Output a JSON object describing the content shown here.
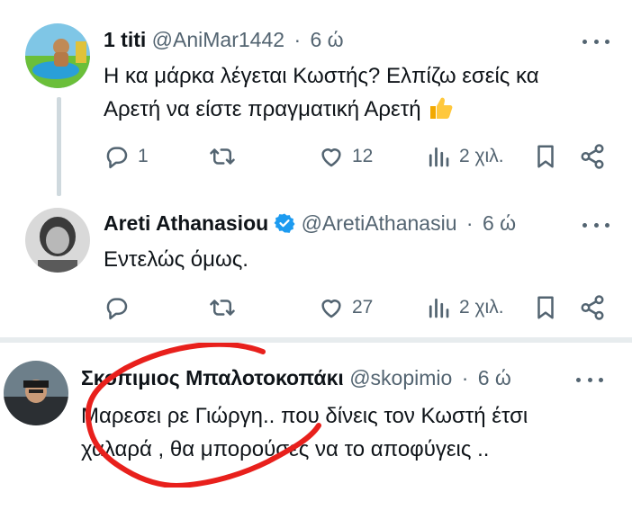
{
  "tweets": [
    {
      "name": "1 titi",
      "handle": "@AniMar1442",
      "separator": "·",
      "time": "6 ώ",
      "text_line1": "Η κα μάρκα λέγεται Κωστής? Ελπίζω εσείς κα",
      "text_line2": "Αρετή να είστε πραγματική Αρετή",
      "emoji": "thumbs-up-icon",
      "replies": "1",
      "retweets": "",
      "likes": "12",
      "views": "2 χιλ."
    },
    {
      "name": "Areti Athanasiou",
      "handle": "@AretiAthanasiu",
      "separator": "·",
      "time": "6 ώ",
      "verified": true,
      "text_line1": "Εντελώς όμως.",
      "replies": "",
      "retweets": "",
      "likes": "27",
      "views": "2 χιλ."
    },
    {
      "name": "Σκοπιμιος Μπαλοτοκοπάκι",
      "handle": "@skopimio",
      "separator": "·",
      "time": "6 ώ",
      "text_line1": "Μαρεσει ρε Γιώργη.. που δίνεις τον Κωστή έτσι",
      "text_line2": "χαλαρά , θα μπορούσες να το αποφύγεις ..",
      "annotation_color": "#e8201c"
    }
  ],
  "colors": {
    "text": "#0f1419",
    "secondary": "#536471",
    "verified": "#1d9bf0",
    "divider": "#e7ecee",
    "thread_line": "#cfd9de"
  }
}
